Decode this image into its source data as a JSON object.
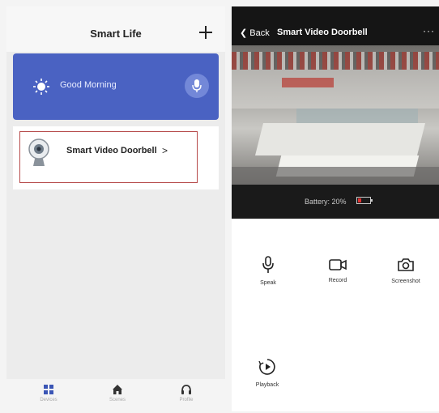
{
  "left_app": {
    "title": "Smart Life",
    "greeting": "Good Morning",
    "device": {
      "name": "Smart  Video Doorbell",
      "arrow": ">"
    },
    "tabs": [
      {
        "label": "Devices",
        "icon": "grid-icon"
      },
      {
        "label": "Scenes",
        "icon": "home-icon"
      },
      {
        "label": "Profile",
        "icon": "headset-icon"
      }
    ]
  },
  "right_app": {
    "back_label": "Back",
    "title": "Smart  Video Doorbell",
    "more_label": "···",
    "battery_text": "Battery: 20%",
    "battery_level": 0.2,
    "controls": [
      {
        "label": "Speak",
        "icon": "microphone-icon"
      },
      {
        "label": "Record",
        "icon": "video-camera-icon"
      },
      {
        "label": "Screenshot",
        "icon": "camera-icon"
      },
      {
        "label": "Playback",
        "icon": "playback-icon"
      }
    ]
  },
  "colors": {
    "greeting_card": "#4a62c2",
    "highlight_border": "#b64a4a",
    "battery_low": "#e03030",
    "tab_active": "#3a55b5"
  }
}
